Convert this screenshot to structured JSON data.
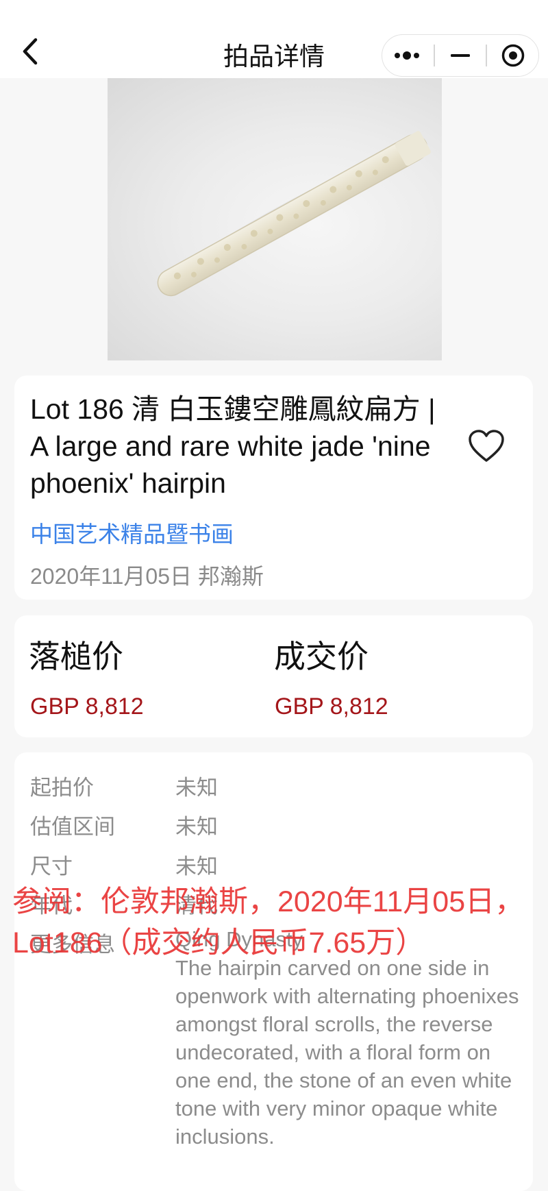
{
  "nav": {
    "title": "拍品详情"
  },
  "lot": {
    "title": "Lot 186 清 白玉鏤空雕鳳紋扁方 | A large and rare white jade 'nine phoenix' hairpin",
    "category": "中国艺术精品暨书画",
    "date_house": "2020年11月05日 邦瀚斯"
  },
  "prices": {
    "hammer_label": "落槌价",
    "hammer_value": "GBP 8,812",
    "deal_label": "成交价",
    "deal_value": "GBP 8,812"
  },
  "info": {
    "start_label": "起拍价",
    "start_value": "未知",
    "estimate_label": "估值区间",
    "estimate_value": "未知",
    "size_label": "尺寸",
    "size_value": "未知",
    "fourth_label": "年代",
    "fourth_value": "清代",
    "more_label": "更多信息",
    "more_first_line": "Qing Dynasty",
    "description": "The hairpin carved on one side in openwork with alternating phoenixes amongst floral scrolls, the reverse undecorated, with a floral form on one end, the stone of an even white tone with very minor opaque white inclusions."
  },
  "watermark": {
    "text": "参阅：伦敦邦瀚斯，2020年11月05日，Lot186（成交约人民币7.65万）"
  },
  "colors": {
    "link": "#3b82e8",
    "price": "#a4161a",
    "watermark": "#e83434",
    "muted": "#8c8c8c"
  },
  "icons": [
    "back-arrow-icon",
    "more-dots-icon",
    "minimize-icon",
    "target-icon",
    "heart-icon"
  ]
}
